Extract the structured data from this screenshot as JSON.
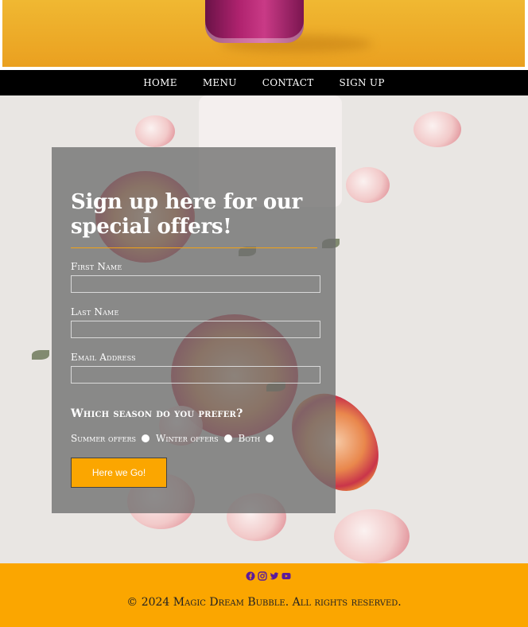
{
  "nav": {
    "items": [
      "HOME",
      "MENU",
      "CONTACT",
      "SIGN UP"
    ]
  },
  "form": {
    "title": "Sign up here for our special offers!",
    "first_name_label": "First Name",
    "last_name_label": "Last Name",
    "email_label": "Email Address",
    "first_name_value": "",
    "last_name_value": "",
    "email_value": "",
    "season_question": "Which season do you prefer?",
    "options": [
      "Summer offers",
      "Winter offers",
      "Both"
    ],
    "submit_label": "Here we Go!"
  },
  "footer": {
    "icons": [
      "facebook-icon",
      "instagram-icon",
      "twitter-icon",
      "youtube-icon"
    ],
    "copyright": "© 2024 Magic Dream Bubble. All rights reserved."
  },
  "colors": {
    "accent": "#fba600",
    "nav_bg": "#000000",
    "icon_color": "#5b1a9c"
  }
}
